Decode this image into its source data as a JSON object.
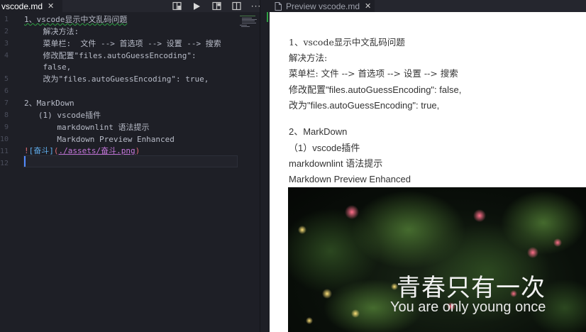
{
  "editor": {
    "tab_label": "vscode.md",
    "close_glyph": "✕",
    "more_glyph": "···",
    "lines": [
      {
        "num": "1",
        "text": "1、vscode显示中文乱码问题"
      },
      {
        "num": "2",
        "text": "    解决方法:"
      },
      {
        "num": "3",
        "text": "    菜单栏:  文件 --> 首选项 --> 设置 --> 搜索"
      },
      {
        "num": "4",
        "text": "    修改配置\"files.autoGuessEncoding\":"
      },
      {
        "num": "",
        "text": "    false,"
      },
      {
        "num": "5",
        "text": "    改为\"files.autoGuessEncoding\": true,"
      },
      {
        "num": "6",
        "text": ""
      },
      {
        "num": "7",
        "text": "2、MarkDown"
      },
      {
        "num": "8",
        "text": "   (1) vscode插件"
      },
      {
        "num": "9",
        "text": "       markdownlint 语法提示"
      },
      {
        "num": "10",
        "text": "       Markdown Preview Enhanced"
      },
      {
        "num": "11",
        "text": ""
      },
      {
        "num": "12",
        "text": ""
      }
    ],
    "image_line": {
      "bang": "!",
      "alt": "[奋斗]",
      "open": "(",
      "link": "./assets/奋斗.png",
      "close": ")"
    }
  },
  "preview": {
    "tab_label": "Preview vscode.md",
    "close_glyph": "✕",
    "lines": [
      "1、vscode显示中文乱码问题",
      "解决方法:",
      "菜单栏: 文件 --> 首选项 --> 设置 --> 搜索",
      "修改配置\"files.autoGuessEncoding\": false,",
      "改为\"files.autoGuessEncoding\": true,",
      "2、MarkDown",
      "（1）vscode插件",
      "markdownlint 语法提示",
      "Markdown Preview Enhanced"
    ],
    "image": {
      "title": "青春只有一次",
      "subtitle": "You are only young once"
    }
  },
  "colors": {
    "editor_bg": "#1e1f26",
    "tab_bar_bg": "#25262e",
    "cursor": "#528bff",
    "squiggle": "#2ea043",
    "link": "#c678dd"
  },
  "icons": [
    "close-icon",
    "open-preview-icon",
    "run-icon",
    "split-preview-icon",
    "split-editor-icon",
    "more-actions-icon",
    "document-icon"
  ]
}
